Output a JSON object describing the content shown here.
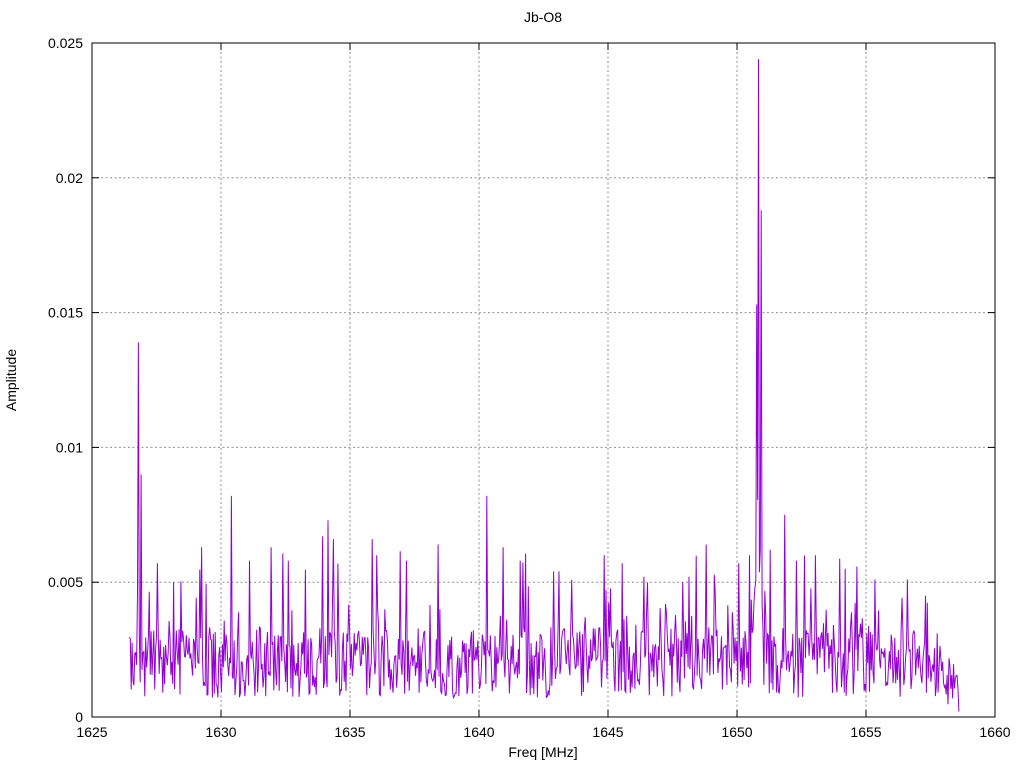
{
  "chart_data": {
    "type": "line",
    "title": "Jb-O8",
    "xlabel": "Freq [MHz]",
    "ylabel": "Amplitude",
    "xlim": [
      1625,
      1660
    ],
    "ylim": [
      0,
      0.025
    ],
    "xticks": {
      "values": [
        1625,
        1630,
        1635,
        1640,
        1645,
        1650,
        1655,
        1660
      ],
      "labels": [
        "1625",
        "1630",
        "1635",
        "1640",
        "1645",
        "1650",
        "1655",
        "1660"
      ]
    },
    "yticks": {
      "values": [
        0,
        0.005,
        0.01,
        0.015,
        0.02,
        0.025
      ],
      "labels": [
        "0",
        "0.005",
        "0.01",
        "0.015",
        "0.02",
        "0.025"
      ]
    },
    "grid": true,
    "legend": "none",
    "background": "#ffffff",
    "axis_color": "#000000",
    "grid_color": "#909090",
    "line_color": "#9400D3",
    "series": [
      {
        "name": "Jb-O8",
        "x_start": 1626.45,
        "x_end": 1658.6,
        "n_points": 920,
        "noise": {
          "seed": 1337,
          "floor": 0.0007,
          "uniform_scale": 0.0026,
          "spike_scale": 0.0033,
          "spike_power": 9
        },
        "taper": {
          "start": 1656.8,
          "end_factor": 0.5
        },
        "boost": {
          "center": 1650.85,
          "halfwidth": 0.35,
          "factor": 1.45
        },
        "end_value": 0.0002,
        "peaks": [
          [
            1626.8,
            0.0139
          ],
          [
            1626.91,
            0.009
          ],
          [
            1627.55,
            0.0057
          ],
          [
            1628.15,
            0.005
          ],
          [
            1629.25,
            0.0063
          ],
          [
            1630.42,
            0.0082
          ],
          [
            1631.1,
            0.0058
          ],
          [
            1631.95,
            0.0063
          ],
          [
            1632.6,
            0.0058
          ],
          [
            1633.95,
            0.0067
          ],
          [
            1634.15,
            0.0073
          ],
          [
            1634.35,
            0.0066
          ],
          [
            1635.85,
            0.0066
          ],
          [
            1636.05,
            0.006
          ],
          [
            1637.2,
            0.0058
          ],
          [
            1638.4,
            0.0064
          ],
          [
            1640.32,
            0.0082
          ],
          [
            1640.95,
            0.0063
          ],
          [
            1641.6,
            0.0058
          ],
          [
            1643.1,
            0.0054
          ],
          [
            1644.85,
            0.006
          ],
          [
            1645.55,
            0.0057
          ],
          [
            1646.4,
            0.0052
          ],
          [
            1647.9,
            0.005
          ],
          [
            1648.8,
            0.0064
          ],
          [
            1650.05,
            0.0057
          ],
          [
            1650.5,
            0.006
          ],
          [
            1650.75,
            0.0153
          ],
          [
            1650.85,
            0.0244
          ],
          [
            1650.95,
            0.0188
          ],
          [
            1651.3,
            0.0062
          ],
          [
            1651.85,
            0.0075
          ],
          [
            1652.3,
            0.0058
          ],
          [
            1653.05,
            0.006
          ],
          [
            1654.2,
            0.0055
          ],
          [
            1655.35,
            0.0051
          ],
          [
            1656.6,
            0.0051
          ],
          [
            1657.3,
            0.0045
          ]
        ]
      }
    ]
  }
}
